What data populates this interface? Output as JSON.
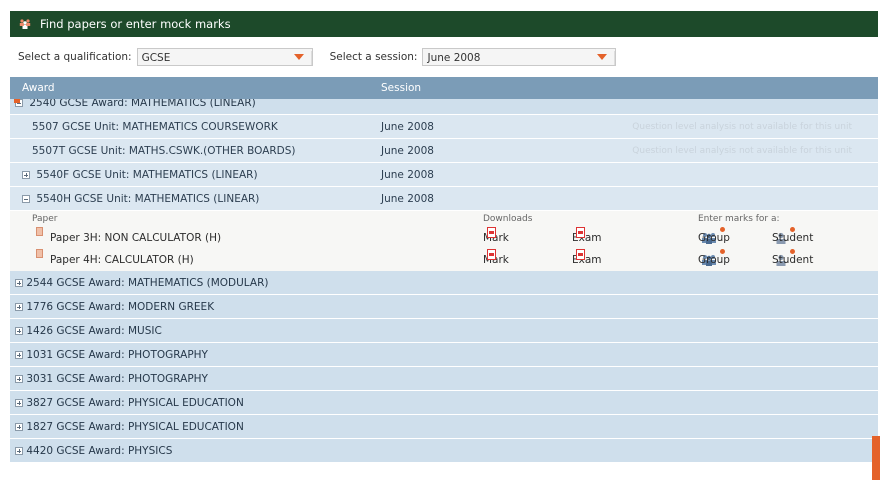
{
  "header": {
    "title": "Find papers or enter mock marks"
  },
  "filters": {
    "qualification_label": "Select a qualification:",
    "qualification_value": "GCSE",
    "session_label": "Select a session:",
    "session_value": "June 2008"
  },
  "table": {
    "col_award": "Award",
    "col_session": "Session",
    "expanded_award": "2540 GCSE Award: MATHEMATICS (LINEAR)",
    "units": [
      {
        "name": "5507 GCSE Unit: MATHEMATICS COURSEWORK",
        "session": "June 2008",
        "note": "Question level analysis not available for this unit"
      },
      {
        "name": "5507T GCSE Unit: MATHS.CSWK.(OTHER BOARDS)",
        "session": "June 2008",
        "note": "Question level analysis not available for this unit"
      },
      {
        "name": "5540F GCSE Unit: MATHEMATICS (LINEAR)",
        "session": "June 2008"
      },
      {
        "name": "5540H GCSE Unit: MATHEMATICS (LINEAR)",
        "session": "June 2008"
      }
    ],
    "paper_header": {
      "paper": "Paper",
      "downloads": "Downloads",
      "enter_marks": "Enter marks for a:"
    },
    "papers": [
      {
        "name": "Paper 3H: NON CALCULATOR (H)",
        "mark_scheme": "Mark scheme",
        "exam_paper": "Exam paper",
        "group": "Group",
        "student": "Student"
      },
      {
        "name": "Paper 4H: CALCULATOR (H)",
        "mark_scheme": "Mark scheme",
        "exam_paper": "Exam paper",
        "group": "Group",
        "student": "Student"
      }
    ],
    "awards": [
      "2544 GCSE Award: MATHEMATICS (MODULAR)",
      "1776 GCSE Award: MODERN GREEK",
      "1426 GCSE Award: MUSIC",
      "1031 GCSE Award: PHOTOGRAPHY",
      "3031 GCSE Award: PHOTOGRAPHY",
      "3827 GCSE Award: PHYSICAL EDUCATION",
      "1827 GCSE Award: PHYSICAL EDUCATION",
      "4420 GCSE Award: PHYSICS"
    ]
  },
  "colors": {
    "header_bg": "#1d4a2a",
    "column_header_bg": "#7b9cb7",
    "award_row_bg": "#cfdfec",
    "accent": "#e4622a"
  }
}
